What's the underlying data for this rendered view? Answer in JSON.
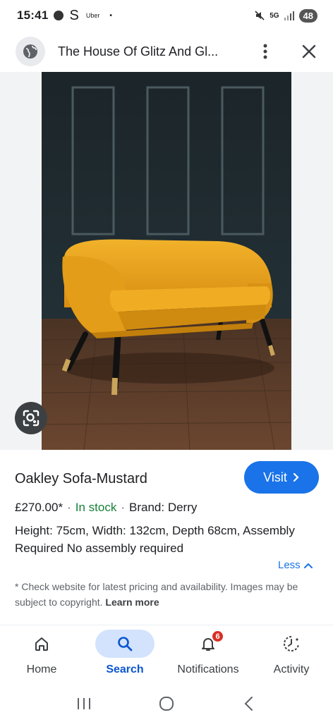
{
  "status_bar": {
    "time": "15:41",
    "s_label": "S",
    "uber_label": "Uber",
    "bullet": "•",
    "network": "5G",
    "battery": "48"
  },
  "header": {
    "title": "The House Of Glitz And Gl..."
  },
  "product": {
    "title": "Oakley Sofa-Mustard",
    "visit_label": "Visit",
    "price": "£270.00*",
    "separator": "·",
    "stock": "In stock",
    "brand": "Brand: Derry",
    "description": "Height: 75cm, Width: 132cm, Depth 68cm, Assembly Required No assembly required",
    "less_label": "Less",
    "disclaimer": "* Check website for latest pricing and availability. Images may be subject to copyright.",
    "learn_more": "Learn more"
  },
  "bottom_nav": {
    "items": [
      {
        "label": "Home",
        "icon": "home-icon"
      },
      {
        "label": "Search",
        "icon": "search-icon",
        "active": true
      },
      {
        "label": "Notifications",
        "icon": "bell-icon",
        "badge": "6"
      },
      {
        "label": "Activity",
        "icon": "activity-icon"
      }
    ]
  },
  "colors": {
    "accent": "#1a73e8",
    "in_stock": "#188038",
    "active_nav_bg": "#d3e3fd",
    "badge": "#d93025",
    "sofa": "#e9a11c",
    "wall": "#1f2a2e",
    "floor": "#5a3a26"
  }
}
